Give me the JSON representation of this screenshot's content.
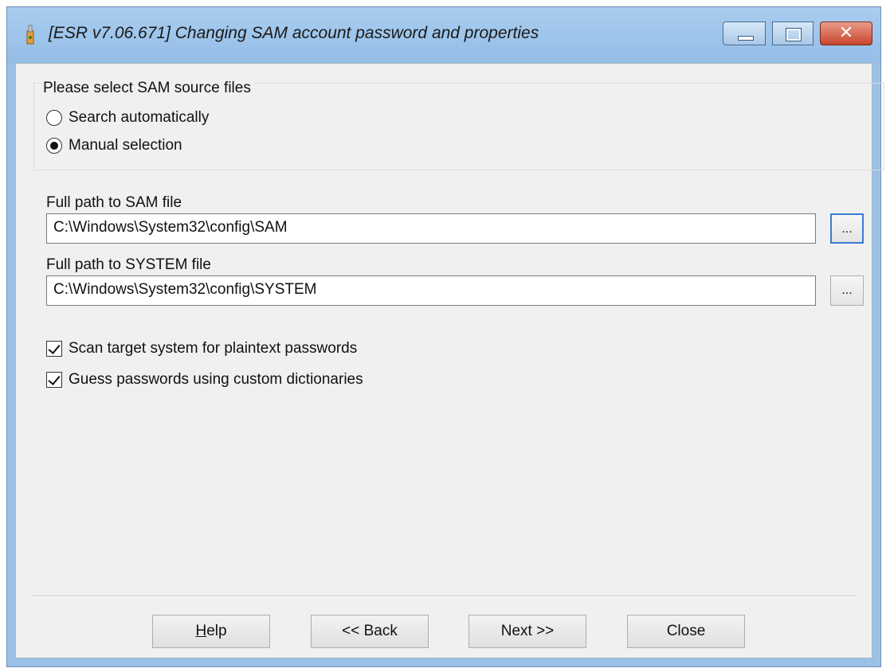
{
  "window": {
    "title": "[ESR v7.06.671]  Changing SAM account password and properties",
    "icon": "app-icon"
  },
  "titlebar_buttons": {
    "minimize_icon": "minimize-icon",
    "maximize_icon": "maximize-icon",
    "close_glyph": "✕"
  },
  "source_group": {
    "label": "Please select SAM source files",
    "options": [
      {
        "label": "Search automatically",
        "checked": false
      },
      {
        "label": "Manual selection",
        "checked": true
      }
    ]
  },
  "sam_file": {
    "label": "Full path to SAM file",
    "value": "C:\\Windows\\System32\\config\\SAM",
    "browse_label": "..."
  },
  "system_file": {
    "label": "Full path to SYSTEM file",
    "value": "C:\\Windows\\System32\\config\\SYSTEM",
    "browse_label": "..."
  },
  "options": [
    {
      "label": "Scan target system for plaintext passwords",
      "checked": true
    },
    {
      "label": "Guess passwords using custom dictionaries",
      "checked": true
    }
  ],
  "buttons": {
    "help_first": "H",
    "help_rest": "elp",
    "back": "<< Back",
    "next": "Next >>",
    "close": "Close"
  }
}
